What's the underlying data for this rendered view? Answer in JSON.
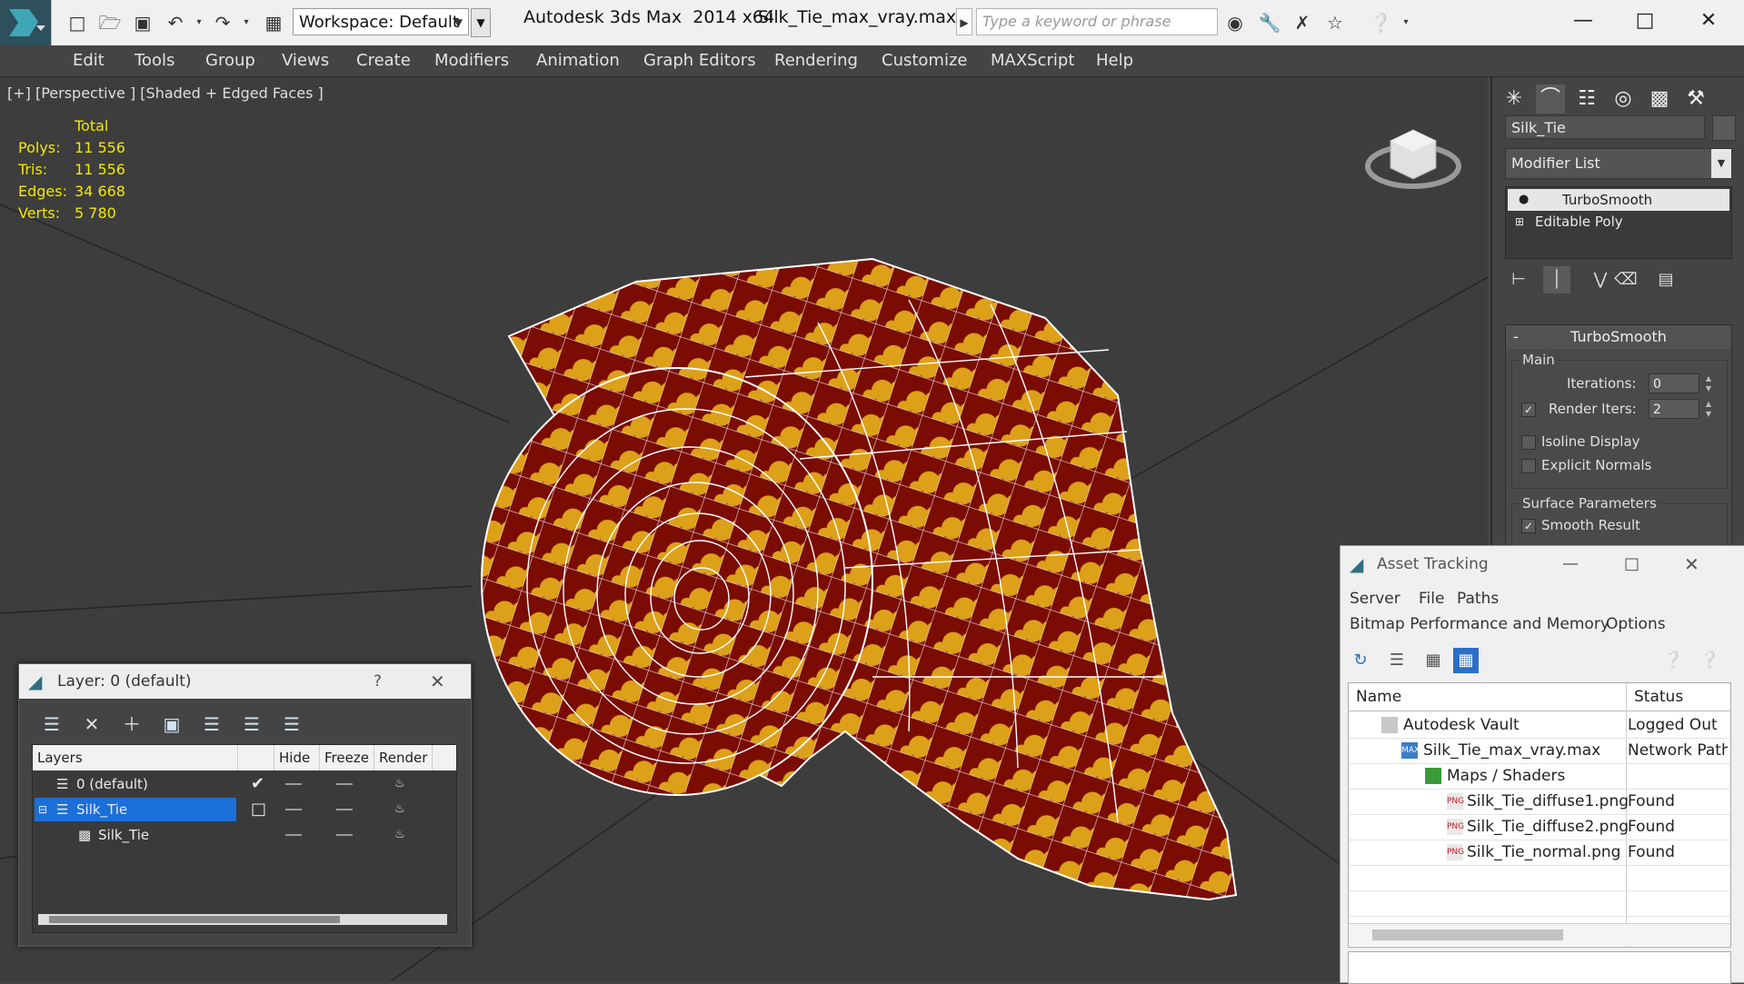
{
  "titlebar": {
    "workspace": "Workspace: Default",
    "app_title": "Autodesk 3ds Max  2014 x64",
    "file_title": "Silk_Tie_max_vray.max",
    "search_placeholder": "Type a keyword or phrase",
    "icons": [
      "new-icon",
      "open-icon",
      "save-icon",
      "undo-icon",
      "redo-icon",
      "project-icon",
      "binoculars-icon",
      "wrench-icon",
      "tools-icon",
      "star-icon",
      "help-icon"
    ]
  },
  "menu": [
    "Edit",
    "Tools",
    "Group",
    "Views",
    "Create",
    "Modifiers",
    "Animation",
    "Graph Editors",
    "Rendering",
    "Customize",
    "MAXScript",
    "Help"
  ],
  "viewport": {
    "label": "[+] [Perspective ] [Shaded + Edged Faces ]",
    "stats_header": "Total",
    "stats": [
      {
        "label": "Polys:",
        "value": "11 556"
      },
      {
        "label": "Tris:",
        "value": "11 556"
      },
      {
        "label": "Edges:",
        "value": "34 668"
      },
      {
        "label": "Verts:",
        "value": "5 780"
      }
    ],
    "colors": {
      "tie_base": "#7a0c04",
      "tie_pattern": "#e3a81a",
      "wire": "#ffffff",
      "stats_text": "#f2e700"
    }
  },
  "command_panel": {
    "object_name": "Silk_Tie",
    "modifier_list": "Modifier List",
    "stack": [
      "TurboSmooth",
      "Editable Poly"
    ],
    "rollout": {
      "title": "TurboSmooth",
      "main_group": "Main",
      "iterations_label": "Iterations:",
      "iterations_value": "0",
      "render_iters_label": "Render Iters:",
      "render_iters_value": "2",
      "render_iters_checked": true,
      "isoline_label": "Isoline Display",
      "explicit_label": "Explicit Normals",
      "surface_group": "Surface Parameters",
      "smooth_result_label": "Smooth Result"
    }
  },
  "layer_dialog": {
    "title": "Layer: 0 (default)",
    "help": "?",
    "columns": [
      "Layers",
      "Hide",
      "Freeze",
      "Render"
    ],
    "rows": [
      {
        "name": "0 (default)",
        "active": true
      },
      {
        "name": "Silk_Tie",
        "selected": true
      },
      {
        "name": "Silk_Tie",
        "object": true
      }
    ]
  },
  "asset_dialog": {
    "title": "Asset Tracking",
    "menu1": [
      "Server",
      "File",
      "Paths"
    ],
    "menu2": [
      "Bitmap Performance and Memory",
      "Options"
    ],
    "columns": [
      "Name",
      "Status"
    ],
    "rows": [
      {
        "name": "Autodesk Vault",
        "status": "Logged Out",
        "indent": 0,
        "icon": "vault-icon"
      },
      {
        "name": "Silk_Tie_max_vray.max",
        "status": "Network Path",
        "indent": 1,
        "icon": "max-file-icon"
      },
      {
        "name": "Maps / Shaders",
        "status": "",
        "indent": 2,
        "icon": "maps-icon"
      },
      {
        "name": "Silk_Tie_diffuse1.png",
        "status": "Found",
        "indent": 3,
        "icon": "png-icon"
      },
      {
        "name": "Silk_Tie_diffuse2.png",
        "status": "Found",
        "indent": 3,
        "icon": "png-icon"
      },
      {
        "name": "Silk_Tie_normal.png",
        "status": "Found",
        "indent": 3,
        "icon": "png-icon"
      }
    ]
  }
}
